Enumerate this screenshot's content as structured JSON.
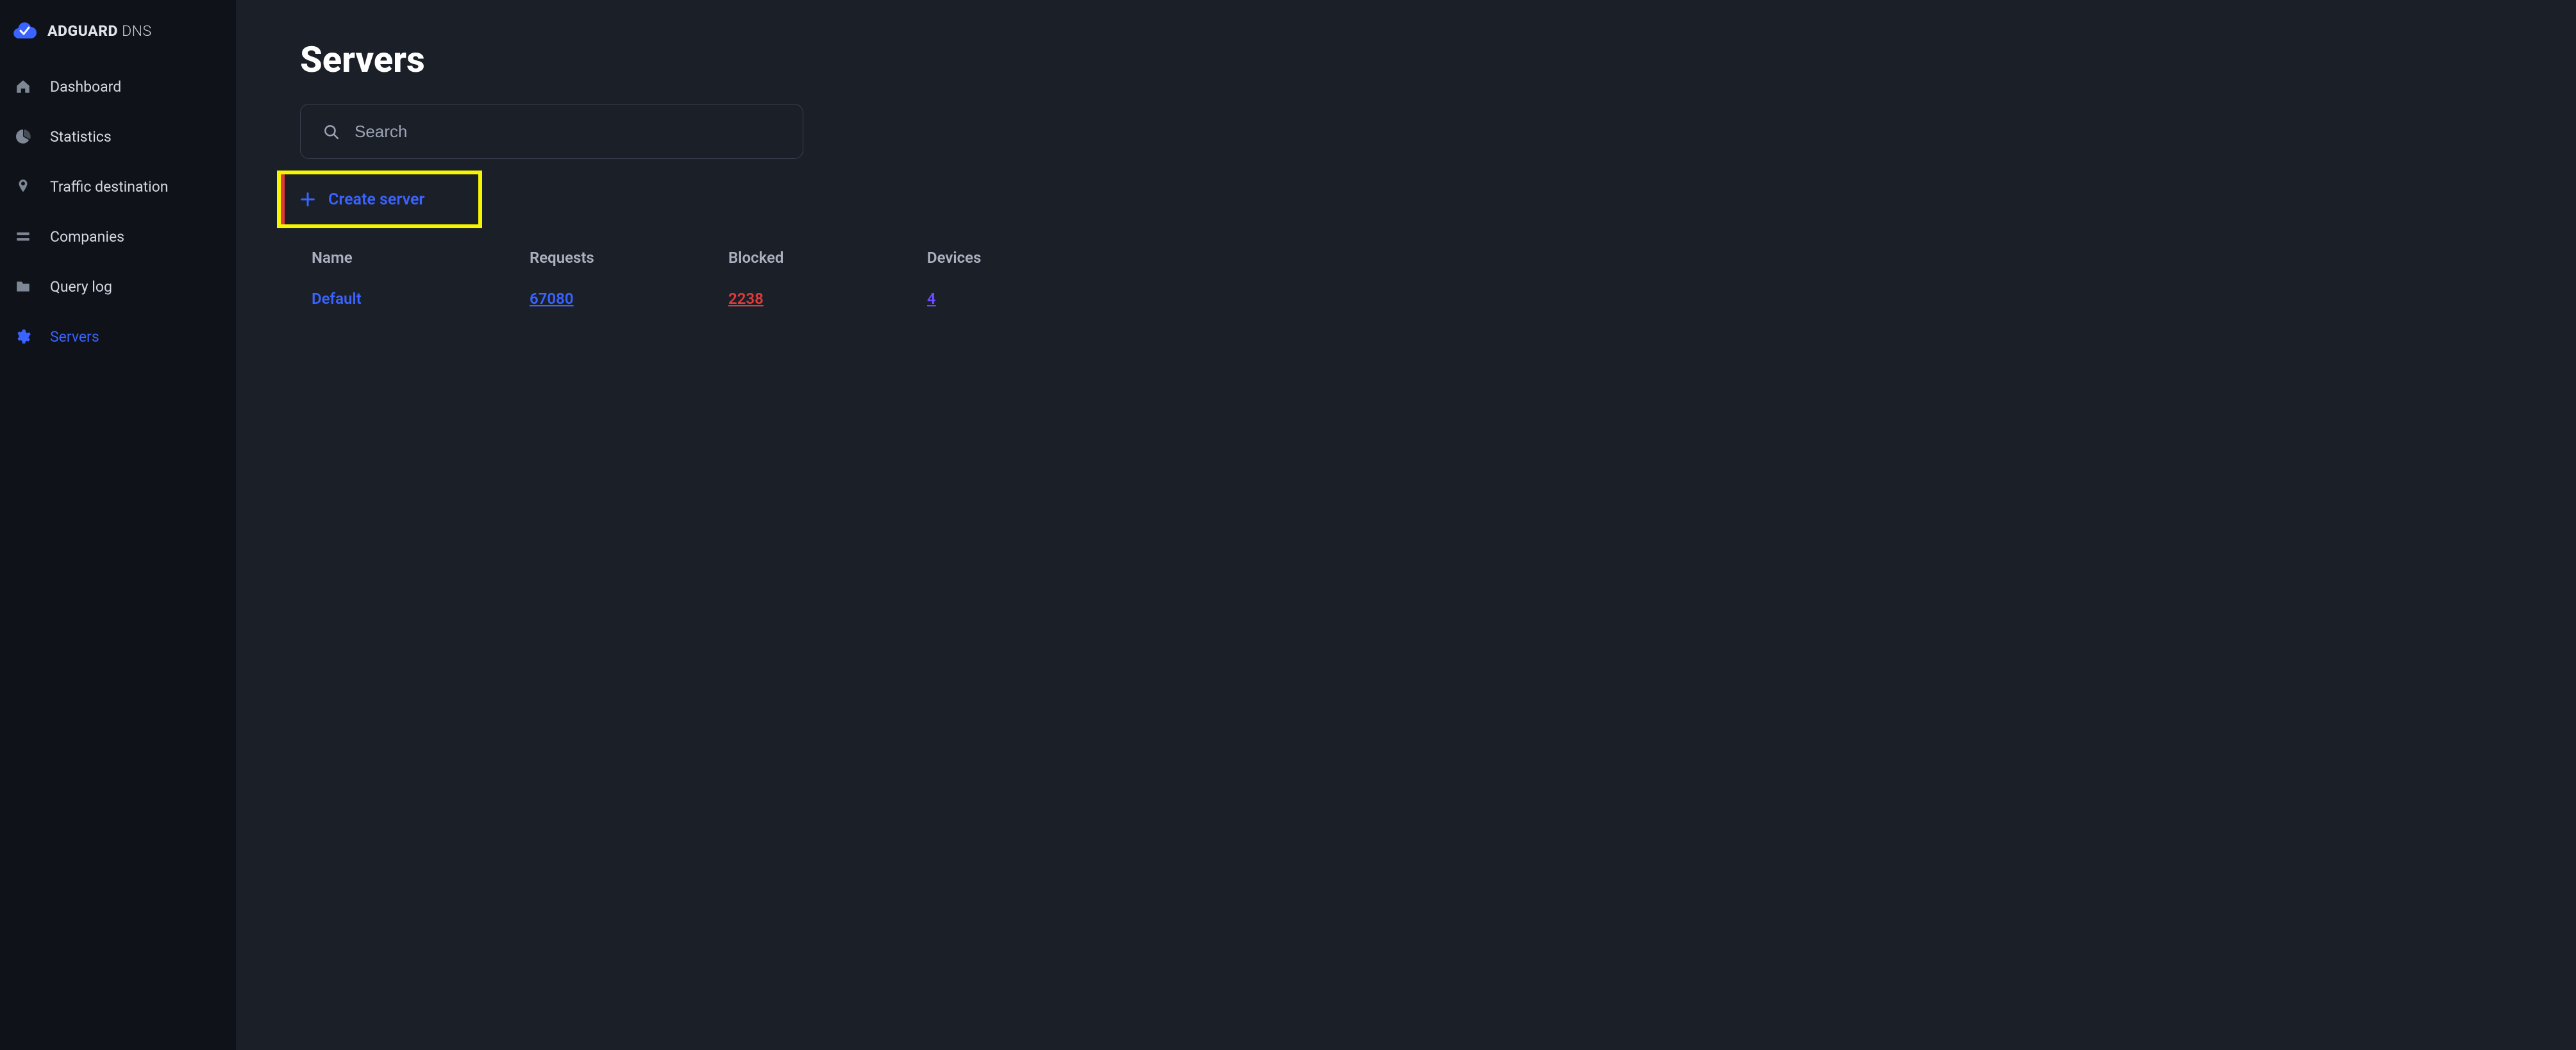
{
  "brand": {
    "bold": "ADGUARD",
    "thin": " DNS"
  },
  "sidebar": {
    "items": [
      {
        "id": "dashboard",
        "label": "Dashboard",
        "icon": "home-icon"
      },
      {
        "id": "statistics",
        "label": "Statistics",
        "icon": "pie-icon"
      },
      {
        "id": "traffic-destination",
        "label": "Traffic destination",
        "icon": "pin-icon"
      },
      {
        "id": "companies",
        "label": "Companies",
        "icon": "list-icon"
      },
      {
        "id": "query-log",
        "label": "Query log",
        "icon": "folder-icon"
      },
      {
        "id": "servers",
        "label": "Servers",
        "icon": "gear-icon",
        "active": true
      }
    ]
  },
  "page": {
    "title": "Servers",
    "search_placeholder": "Search",
    "create_label": "Create server"
  },
  "table": {
    "headers": {
      "name": "Name",
      "requests": "Requests",
      "blocked": "Blocked",
      "devices": "Devices"
    },
    "rows": [
      {
        "name": "Default",
        "requests": "67080",
        "blocked": "2238",
        "devices": "4"
      }
    ]
  },
  "colors": {
    "accent": "#3a63ff",
    "danger": "#e03a3a",
    "violet": "#6a4bff",
    "highlight": "#f5f500"
  }
}
